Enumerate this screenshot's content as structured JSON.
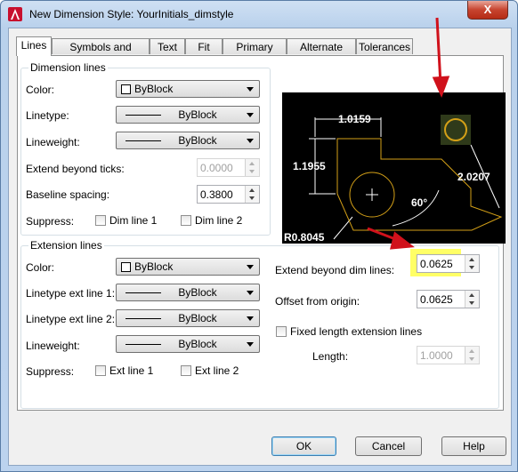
{
  "window": {
    "title": "New Dimension Style: YourInitials_dimstyle",
    "close_glyph": "X"
  },
  "tabs": [
    {
      "label": "Lines",
      "active": true
    },
    {
      "label": "Symbols and Arrows",
      "active": false
    },
    {
      "label": "Text",
      "active": false
    },
    {
      "label": "Fit",
      "active": false
    },
    {
      "label": "Primary Units",
      "active": false
    },
    {
      "label": "Alternate Units",
      "active": false
    },
    {
      "label": "Tolerances",
      "active": false
    }
  ],
  "dimension_lines": {
    "title": "Dimension lines",
    "color_label": "Color:",
    "color_value": "ByBlock",
    "linetype_label": "Linetype:",
    "linetype_value": "ByBlock",
    "lineweight_label": "Lineweight:",
    "lineweight_value": "ByBlock",
    "extend_label": "Extend beyond ticks:",
    "extend_value": "0.0000",
    "baseline_label": "Baseline spacing:",
    "baseline_value": "0.3800",
    "suppress_label": "Suppress:",
    "dim1_label": "Dim line 1",
    "dim2_label": "Dim line 2"
  },
  "extension_lines": {
    "title": "Extension lines",
    "color_label": "Color:",
    "color_value": "ByBlock",
    "ltype1_label": "Linetype ext line 1:",
    "ltype1_value": "ByBlock",
    "ltype2_label": "Linetype ext line 2:",
    "ltype2_value": "ByBlock",
    "lineweight_label": "Lineweight:",
    "lineweight_value": "ByBlock",
    "suppress_label": "Suppress:",
    "ext1_label": "Ext line 1",
    "ext2_label": "Ext line 2",
    "extend_label": "Extend beyond dim lines:",
    "extend_value": "0.0625",
    "offset_label": "Offset from origin:",
    "offset_value": "0.0625",
    "fixed_label": "Fixed length extension lines",
    "length_label": "Length:",
    "length_value": "1.0000"
  },
  "preview": {
    "dim_top": "1.0159",
    "dim_left": "1.1955",
    "dim_right": "2.0207",
    "angle": "60°",
    "radius": "R0.8045"
  },
  "buttons": {
    "ok": "OK",
    "cancel": "Cancel",
    "help": "Help"
  },
  "colors": {
    "annotation_arrow": "#d0111b",
    "highlight": "#ffff66",
    "preview_lines": "#d4a017"
  }
}
